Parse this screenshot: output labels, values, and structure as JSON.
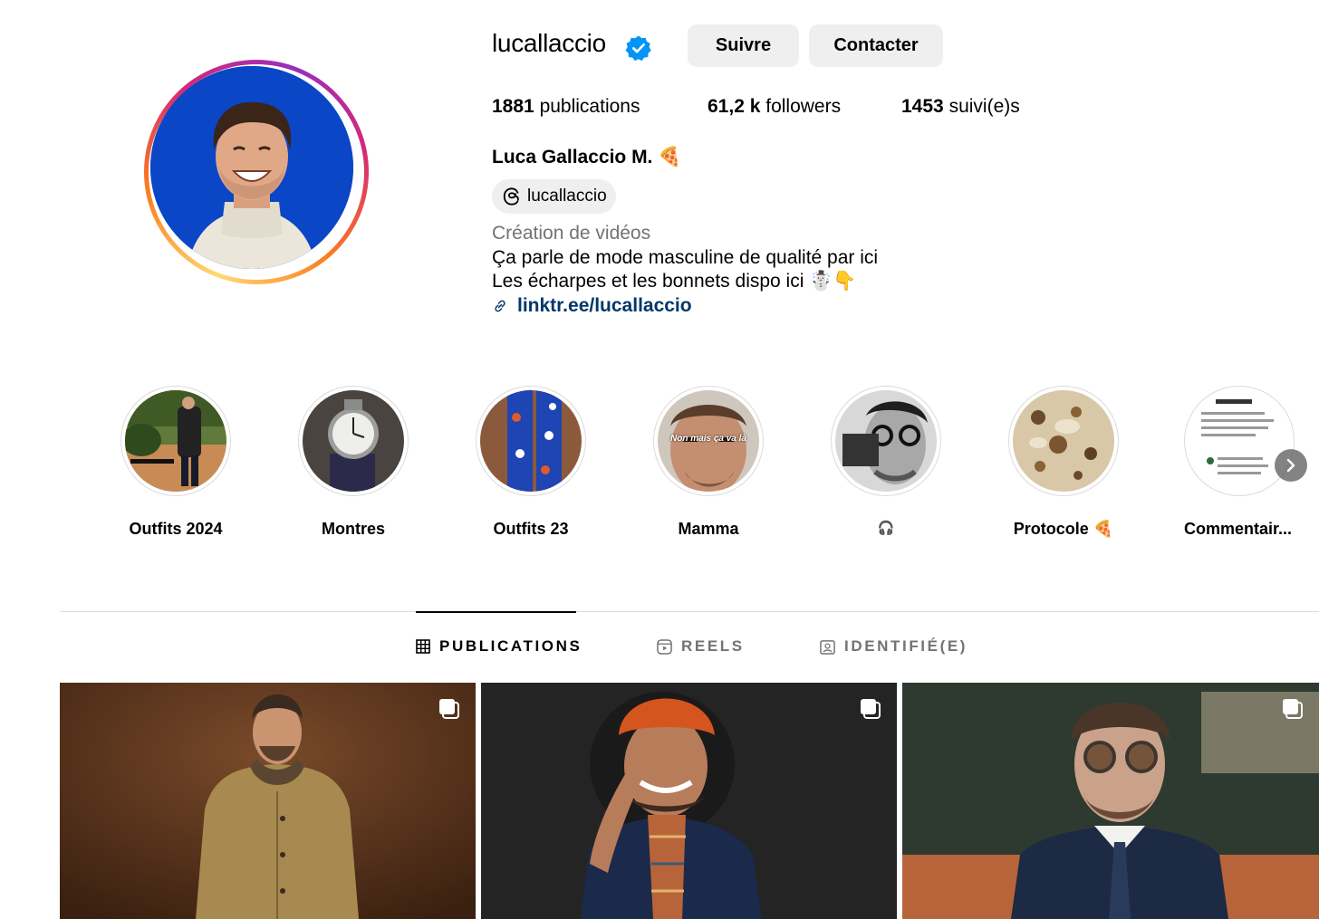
{
  "profile": {
    "username": "lucallaccio",
    "verified": true,
    "follow_label": "Suivre",
    "contact_label": "Contacter",
    "stats": {
      "posts_count": "1881",
      "posts_label": "publications",
      "followers_count": "61,2 k",
      "followers_label": "followers",
      "following_count": "1453",
      "following_label": "suivi(e)s"
    },
    "full_name": "Luca Gallaccio M. 🍕",
    "threads_handle": "lucallaccio",
    "category": "Création de vidéos",
    "bio_lines": [
      "Ça parle de mode masculine de qualité par ici",
      "Les écharpes et les bonnets dispo ici ☃️👇"
    ],
    "link": "linktr.ee/lucallaccio"
  },
  "highlights": [
    {
      "label": "Outfits 2024"
    },
    {
      "label": "Montres"
    },
    {
      "label": "Outfits 23"
    },
    {
      "label": "Mamma",
      "overlay_text": "Non mais ça va là"
    },
    {
      "label": "🎧"
    },
    {
      "label": "Protocole 🍕"
    },
    {
      "label": "Commentair..."
    }
  ],
  "tabs": [
    {
      "label": "PUBLICATIONS",
      "icon": "grid-icon",
      "active": true
    },
    {
      "label": "REELS",
      "icon": "reels-icon",
      "active": false
    },
    {
      "label": "IDENTIFIÉ(E)",
      "icon": "tagged-icon",
      "active": false
    }
  ],
  "colors": {
    "avatar_background": "#0a46c6",
    "link": "#00376b",
    "verified_badge": "#0095f6",
    "button_background": "#efefef"
  }
}
